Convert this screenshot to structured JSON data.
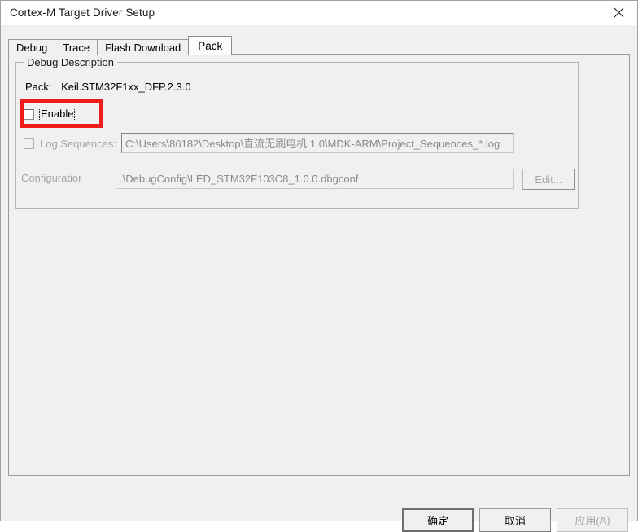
{
  "window": {
    "title": "Cortex-M Target Driver Setup",
    "close_icon": "close-icon"
  },
  "tabs": [
    {
      "label": "Debug",
      "selected": false
    },
    {
      "label": "Trace",
      "selected": false
    },
    {
      "label": "Flash Download",
      "selected": false
    },
    {
      "label": "Pack",
      "selected": true
    }
  ],
  "debug_description": {
    "legend": "Debug Description",
    "pack": {
      "label": "Pack:",
      "value": "Keil.STM32F1xx_DFP.2.3.0"
    },
    "enable": {
      "label": "Enable",
      "checked": false,
      "focused": true,
      "highlight_color": "#ee1c1c"
    },
    "log_sequences": {
      "label": "Log Sequences:",
      "checked": false,
      "enabled": false,
      "value": "C:\\Users\\86182\\Desktop\\直流无刷电机 1.0\\MDK-ARM\\Project_Sequences_*.log"
    },
    "configuration": {
      "label": "Configuratior",
      "value": ".\\DebugConfig\\LED_STM32F103C8_1.0.0.dbgconf",
      "edit_button": "Edit..."
    }
  },
  "footer": {
    "ok": "确定",
    "cancel": "取消",
    "apply_prefix": "应用(",
    "apply_accel": "A",
    "apply_suffix": ")"
  }
}
